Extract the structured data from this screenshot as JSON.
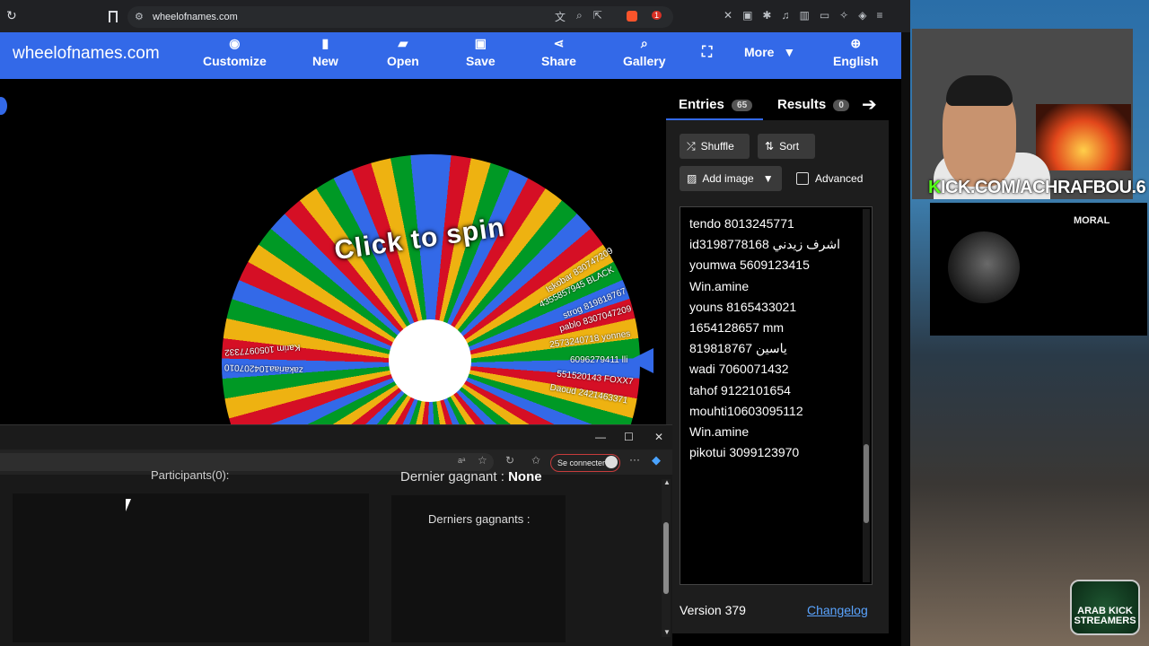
{
  "browser": {
    "url": "wheelofnames.com",
    "badge": "1"
  },
  "header": {
    "logo": "wheelofnames.com",
    "nav": [
      {
        "label": "Customize",
        "icon": "palette-icon"
      },
      {
        "label": "New",
        "icon": "file-icon"
      },
      {
        "label": "Open",
        "icon": "folder-icon"
      },
      {
        "label": "Save",
        "icon": "save-icon"
      },
      {
        "label": "Share",
        "icon": "share-icon"
      },
      {
        "label": "Gallery",
        "icon": "search-icon"
      },
      {
        "label": "More",
        "icon": "fullscreen-icon"
      },
      {
        "label": "English",
        "icon": "globe-icon"
      }
    ]
  },
  "wheel": {
    "spin_text": "Click to spin",
    "visible_labels": [
      "6096279411 lli",
      "2573240718 yonnes",
      "pablo 8307047209",
      "strog 819818767",
      "4355857945 BLACK",
      "Iskobar 830747209",
      "Daoud 2421463371",
      "551520143 FOXX7",
      "Karim 1050977332",
      "zakariaa104207010"
    ]
  },
  "sidebar": {
    "tabs": [
      {
        "label": "Entries",
        "count": "65"
      },
      {
        "label": "Results",
        "count": "0"
      }
    ],
    "buttons": {
      "shuffle": "Shuffle",
      "sort": "Sort",
      "add_image": "Add image",
      "advanced": "Advanced"
    },
    "entries": [
      "tendo 8013245771",
      "id3198778168 اشرف زيدني",
      "youmwa 5609123415",
      "Win.amine",
      " youns 8165433021",
      "1654128657 mm",
      "819818767 ياسين",
      "wadi 7060071432",
      "tahof 9122101654",
      "mouhti10603095112",
      "Win.amine",
      "pikotui 3099123970"
    ],
    "version": "Version 379",
    "changelog": "Changelog"
  },
  "overlay_browser": {
    "connect_button": "Se connecter",
    "participants_title": "Participants(0):",
    "last_winner_label": "Dernier gagnant :",
    "last_winner_value": "None",
    "last_winners_title": "Derniers gagnants :"
  },
  "stream": {
    "channel": "ICK.COM/ACHRAFBOU.6",
    "channel_k": "K",
    "moral_logo": "MORAL",
    "badge_text": "ARAB KICK STREAMERS"
  },
  "colors": {
    "header_blue": "#3369e8",
    "wheel": [
      "#3369e8",
      "#d50f25",
      "#eeb211",
      "#009925"
    ],
    "kick_green": "#53fc18"
  }
}
